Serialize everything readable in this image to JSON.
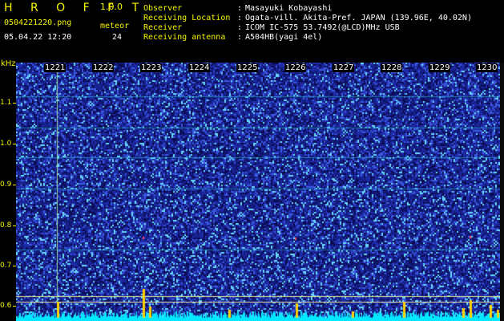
{
  "header": {
    "brand": "H R O F F T",
    "version": "1.0.0",
    "filename": "0504221220.png",
    "datetime": "05.04.22 12:20",
    "meteor_label": "meteor",
    "meteor_count": "24"
  },
  "station": {
    "observer_label": "Observer",
    "observer_value": "Masayuki Kobayashi",
    "location_label": "Receiving Location",
    "location_value": "Ogata-vill. Akita-Pref. JAPAN (139.96E, 40.02N)",
    "receiver_label": "Receiver",
    "receiver_value": "ICOM IC-575 53.7492(@LCD)MHz USB",
    "antenna_label": "Receiving antenna",
    "antenna_value": "A504HB(yagi 4el)",
    "separator": ":"
  },
  "axis": {
    "unit": "kHz",
    "y_labels": [
      "1.1",
      "1.0",
      "0.9",
      "0.8",
      "0.7",
      "0.6"
    ],
    "x_labels": [
      "1221",
      "1222",
      "1223",
      "1224",
      "1225",
      "1226",
      "1227",
      "1228",
      "1229",
      "1230"
    ]
  },
  "colors": {
    "label_yellow": "#f4f400",
    "text_white": "#ffffff",
    "spectrum_dark": "#0a0a55",
    "spectrum_mid": "#2a3cc8",
    "spectrum_bright": "#6ad8ff",
    "gridline_cyan": "#2fc8d8",
    "baseline_cyan": "#00e8ff",
    "echo_yellow": "#ffd000"
  }
}
